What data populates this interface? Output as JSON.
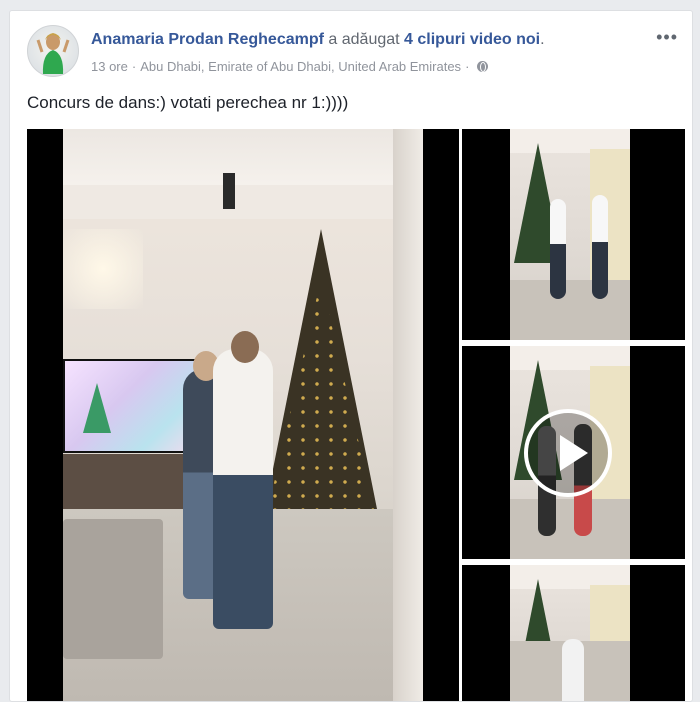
{
  "post": {
    "author": "Anamaria Prodan Reghecampf",
    "action_prefix": "a adăugat",
    "action_count": "4 clipuri video noi",
    "action_suffix": ".",
    "time": "13 ore",
    "separator": "·",
    "location": "Abu Dhabi, Emirate of Abu Dhabi, United Arab Emirates",
    "privacy_icon": "globe-icon",
    "more_label": "•••",
    "text": "Concurs de dans:) votati perechea nr 1:))))"
  },
  "media": {
    "video_count": 4,
    "play_icon": "play-icon"
  },
  "colors": {
    "link": "#365899",
    "meta": "#90949c",
    "text": "#1d2129",
    "background": "#e9ebee"
  }
}
